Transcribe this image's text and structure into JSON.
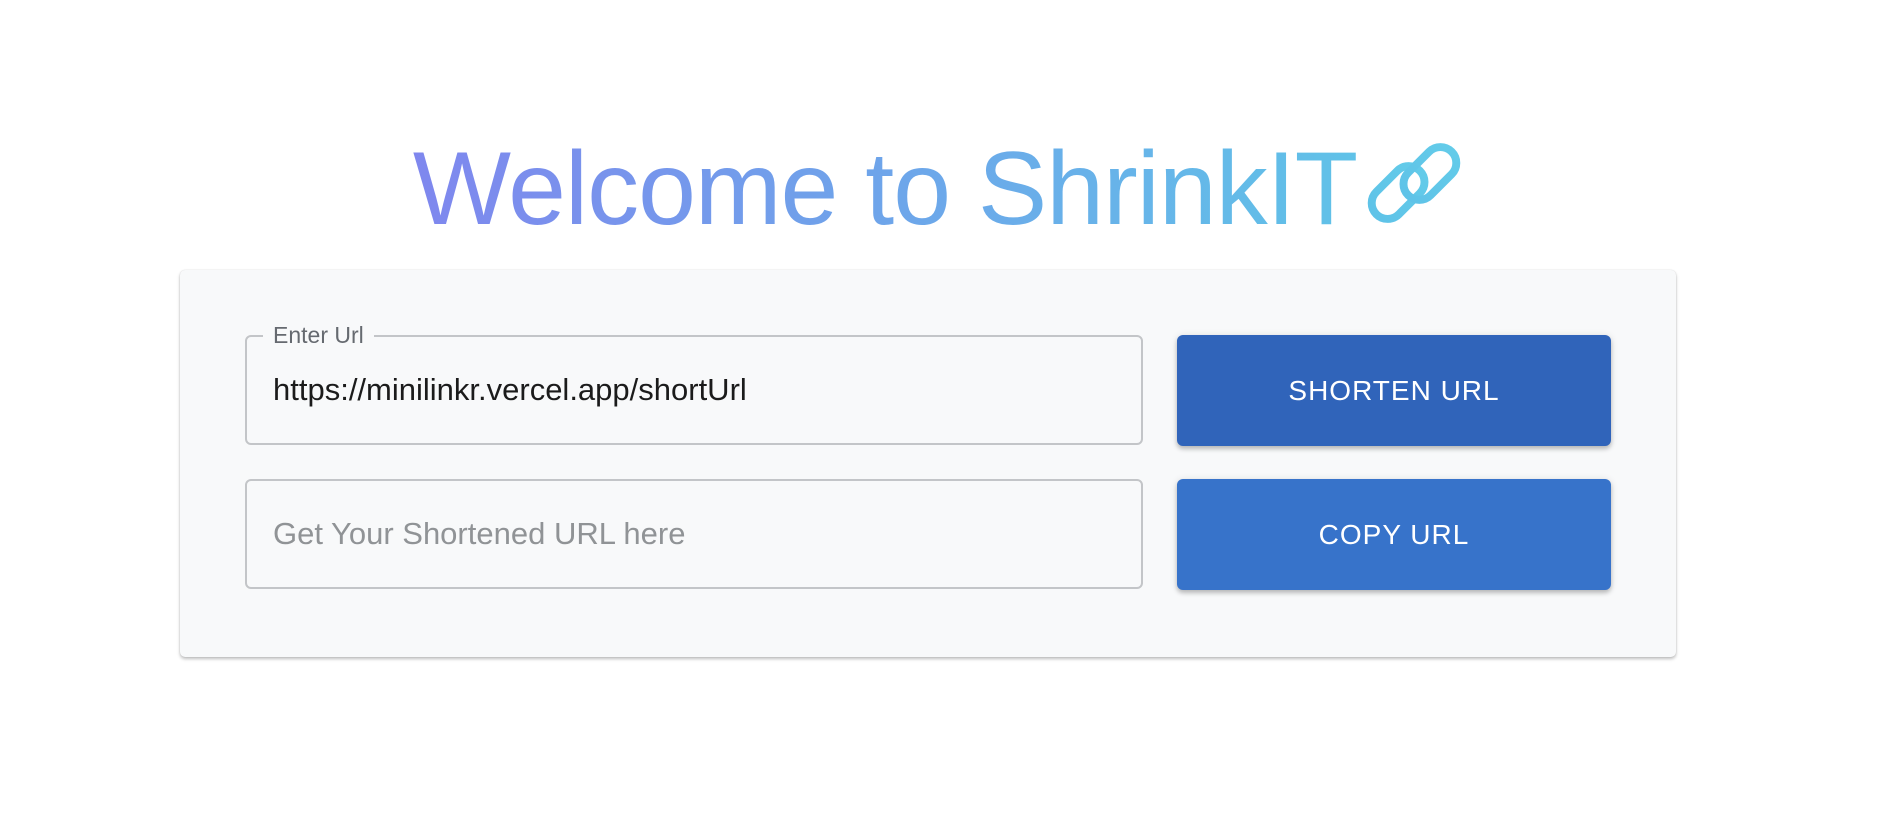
{
  "header": {
    "title": "Welcome to ShrinkIT",
    "icon": "link-icon"
  },
  "form": {
    "url_field": {
      "label": "Enter Url",
      "value": "https://minilinkr.vercel.app/shortUrl"
    },
    "result_field": {
      "placeholder": "Get Your Shortened URL here",
      "value": ""
    },
    "shorten_button_label": "SHORTEN URL",
    "copy_button_label": "COPY URL"
  },
  "colors": {
    "title_gradient_start": "#7f87ee",
    "title_gradient_end": "#60c2e8",
    "shorten_button": "#3064ba",
    "copy_button": "#3773ca",
    "card_background": "#f8f9fa"
  }
}
